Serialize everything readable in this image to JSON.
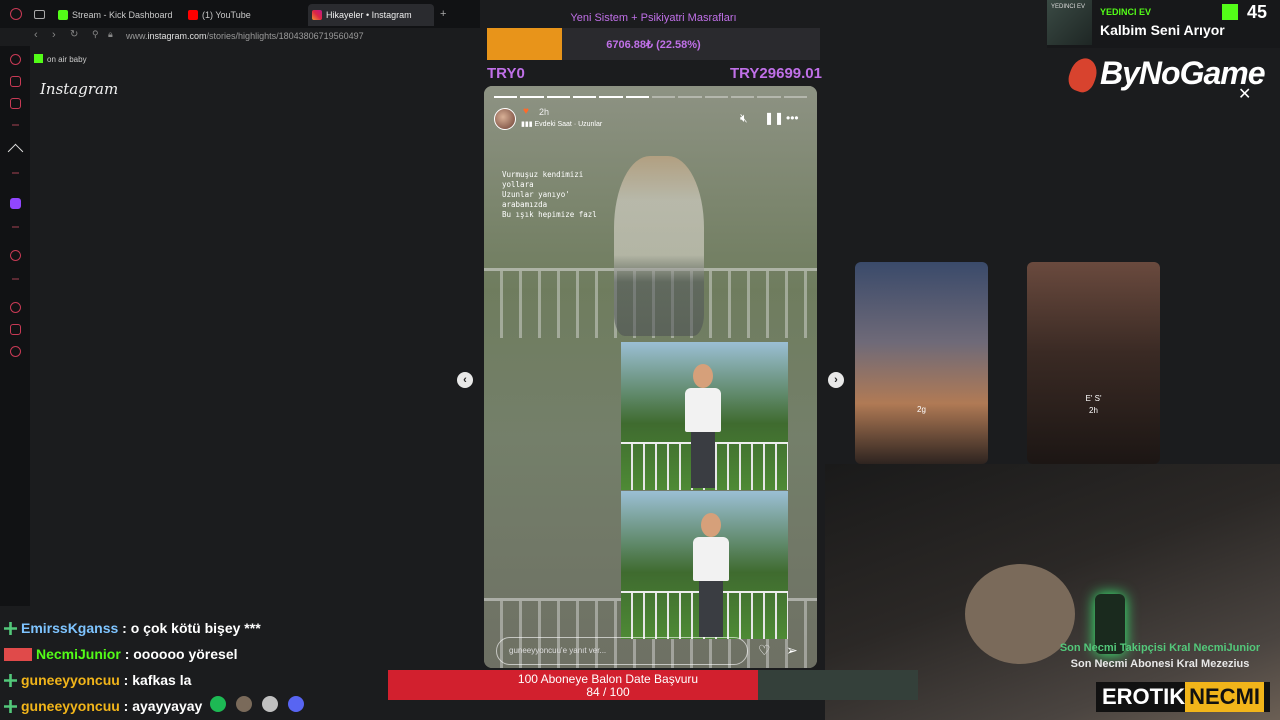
{
  "browser": {
    "tabs": [
      {
        "label": "Stream - Kick Dashboard",
        "color": "#53fc18"
      },
      {
        "label": "(1) YouTube",
        "color": "#ff0000"
      },
      {
        "label": "Hikayeler • Instagram",
        "color": "#d6249f"
      }
    ],
    "url_prefix": "www.",
    "url_host": "instagram.com",
    "url_path": "/stories/highlights/18043806719560497",
    "bookmark": "on air baby"
  },
  "instagram": {
    "logo": "Instagram"
  },
  "donation": {
    "title": "Yeni Sistem + Psikiyatri Masrafları",
    "amount": "6706.88₺ (22.58%)",
    "progress_percent": 22.58,
    "min": "TRY0",
    "max": "TRY29699.01"
  },
  "story": {
    "time_ago": "2h",
    "music": "Evdeki Saat · Uzunlar",
    "lyrics": "Vurmuşuz kendimizi\nyollara\nUzunlar yanıyo'\narabamızda\nBu ışık hepimize fazl",
    "reply_placeholder": "guneeyyoncuu'e yanıt ver...",
    "segments_total": 12,
    "segments_done": 6
  },
  "thumbnails": [
    {
      "label": "2g"
    },
    {
      "label": "E' S'\n2h"
    }
  ],
  "now_playing": {
    "album_text": "YEDINCI EV",
    "artist": "YEDINCI EV",
    "track": "Kalbim Seni Arıyor",
    "viewers": "45"
  },
  "sponsor": "ByNoGame",
  "subs": {
    "line1": "Son Necmi Takipçisi Kral NecmiJunior",
    "line2": "Son Necmi Abonesi Kral Mezezius"
  },
  "brand": {
    "white": "EROTIK",
    "yellow": "NECMI"
  },
  "goal": {
    "title": "100 Aboneye Balon Date Başvuru",
    "count": "84 / 100",
    "current": 84,
    "target": 100
  },
  "chat": [
    {
      "user": "EmirssKganss",
      "text": " : o çok kötü bişey ***"
    },
    {
      "user": "NecmiJunior",
      "text": " : oooooo yöresel"
    },
    {
      "user": "guneeyyoncuu",
      "text": " : kafkas la"
    },
    {
      "user": "guneeyyoncuu",
      "text": " : ayayyayay"
    }
  ],
  "colors": {
    "accent_purple": "#c070e8",
    "donation_fill": "#e8941a",
    "goal_fill": "#d2202e",
    "kick_green": "#53fc18",
    "brand_yellow": "#f2b51a"
  }
}
